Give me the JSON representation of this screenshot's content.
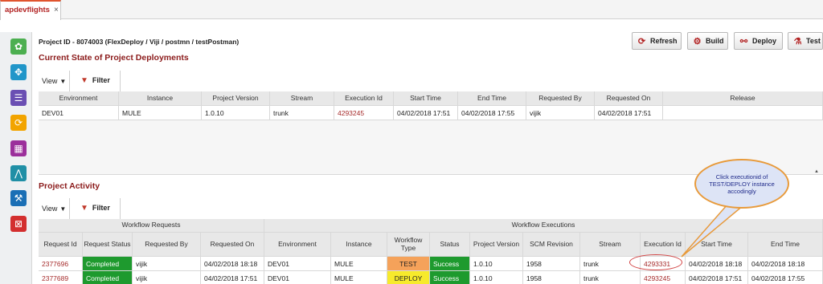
{
  "tab": {
    "title": "apdevflights",
    "close": "×"
  },
  "header": {
    "project_id": "Project ID - 8074003 (FlexDeploy / Viji / postmn / testPostman)"
  },
  "toolbar": {
    "refresh": "Refresh",
    "build": "Build",
    "deploy": "Deploy",
    "test": "Test"
  },
  "sidebar": {
    "icons": [
      {
        "name": "settings-icon",
        "color": "#4caf50",
        "glyph": "✿"
      },
      {
        "name": "network-icon",
        "color": "#2196c9",
        "glyph": "✥"
      },
      {
        "name": "list-icon",
        "color": "#6a4fb3",
        "glyph": "☰"
      },
      {
        "name": "refresh-icon",
        "color": "#f2a400",
        "glyph": "⟳"
      },
      {
        "name": "report-icon",
        "color": "#9b2f9b",
        "glyph": "▦"
      },
      {
        "name": "flow-icon",
        "color": "#1f8fa6",
        "glyph": "⋀"
      },
      {
        "name": "tools-icon",
        "color": "#1b6fb5",
        "glyph": "⚒"
      },
      {
        "name": "lock-icon",
        "color": "#d32f2f",
        "glyph": "⊠"
      }
    ]
  },
  "deployments": {
    "title": "Current State of Project Deployments",
    "view_label": "View",
    "filter_label": "Filter",
    "columns": [
      "Environment",
      "Instance",
      "Project Version",
      "Stream",
      "Execution Id",
      "Start Time",
      "End Time",
      "Requested By",
      "Requested On",
      "Release"
    ],
    "rows": [
      [
        "DEV01",
        "MULE",
        "1.0.10",
        "trunk",
        "4293245",
        "04/02/2018 17:51",
        "04/02/2018 17:55",
        "vijik",
        "04/02/2018 17:51",
        ""
      ]
    ]
  },
  "activity": {
    "title": "Project Activity",
    "view_label": "View",
    "filter_label": "Filter",
    "group_requests": "Workflow Requests",
    "group_executions": "Workflow Executions",
    "columns": [
      "Request Id",
      "Request Status",
      "Requested By",
      "Requested On",
      "Environment",
      "Instance",
      "Workflow Type",
      "Status",
      "Project Version",
      "SCM Revision",
      "Stream",
      "Execution Id",
      "Start Time",
      "End Time"
    ],
    "rows": [
      [
        "2377696",
        "Completed",
        "vijik",
        "04/02/2018 18:18",
        "DEV01",
        "MULE",
        "TEST",
        "Success",
        "1.0.10",
        "1958",
        "trunk",
        "4293331",
        "04/02/2018 18:18",
        "04/02/2018 18:18"
      ],
      [
        "2377689",
        "Completed",
        "vijik",
        "04/02/2018 17:51",
        "DEV01",
        "MULE",
        "DEPLOY",
        "Success",
        "1.0.10",
        "1958",
        "trunk",
        "4293245",
        "04/02/2018 17:51",
        "04/02/2018 17:55"
      ]
    ]
  },
  "callout": {
    "text": "Click executionid of TEST/DEPLOY instance accodingly"
  },
  "colors": {
    "accent": "#8b1a1a",
    "success": "#1e9a2e",
    "test": "#f5a25a",
    "deploy": "#f7ea2c"
  }
}
